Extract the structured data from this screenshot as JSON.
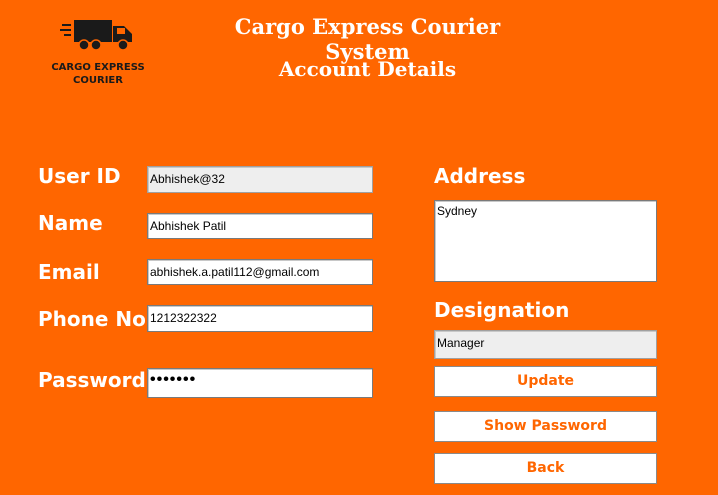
{
  "header": {
    "logo_text": "CARGO EXPRESS COURIER",
    "app_title": "Cargo Express Courier System",
    "page_title": "Account Details"
  },
  "form": {
    "user_id": {
      "label": "User ID",
      "value": "Abhishek@32"
    },
    "name": {
      "label": "Name",
      "value": "Abhishek Patil"
    },
    "email": {
      "label": "Email",
      "value": "abhishek.a.patil112@gmail.com"
    },
    "phone": {
      "label": "Phone No",
      "value": "1212322322"
    },
    "password": {
      "label": "Password",
      "value": "•••••••"
    },
    "address": {
      "label": "Address",
      "value": "Sydney"
    },
    "designation": {
      "label": "Designation",
      "value": "Manager"
    }
  },
  "buttons": {
    "update": "Update",
    "show_password": "Show Password",
    "back": "Back"
  },
  "colors": {
    "background": "#ff6600",
    "button_text": "#ff6600",
    "label_text": "#ffffff"
  },
  "icons": {
    "logo": "delivery-truck-icon"
  }
}
